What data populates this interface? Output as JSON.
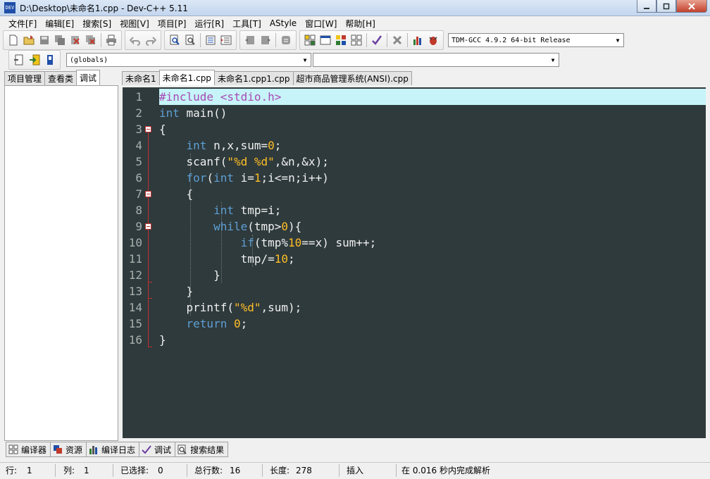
{
  "window": {
    "title": "D:\\Desktop\\未命名1.cpp - Dev-C++ 5.11",
    "icon_text": "DEV"
  },
  "menu": [
    "文件[F]",
    "编辑[E]",
    "搜索[S]",
    "视图[V]",
    "项目[P]",
    "运行[R]",
    "工具[T]",
    "AStyle",
    "窗口[W]",
    "帮助[H]"
  ],
  "compiler_select": {
    "value": "TDM-GCC 4.9.2 64-bit Release"
  },
  "scope_select": {
    "value": "(globals)"
  },
  "member_select": {
    "value": ""
  },
  "left_tabs": [
    {
      "label": "项目管理"
    },
    {
      "label": "查看类"
    },
    {
      "label": "调试"
    }
  ],
  "left_active_tab": "调试",
  "editor_tabs": [
    {
      "label": "未命名1"
    },
    {
      "label": "未命名1.cpp"
    },
    {
      "label": "未命名1.cpp1.cpp"
    },
    {
      "label": "超市商品管理系统(ANSI).cpp"
    }
  ],
  "editor_active_tab": "未命名1.cpp",
  "line_numbers": [
    "1",
    "2",
    "3",
    "4",
    "5",
    "6",
    "7",
    "8",
    "9",
    "10",
    "11",
    "12",
    "13",
    "14",
    "15",
    "16"
  ],
  "code_lines": [
    "#include <stdio.h>",
    "int main()",
    "{",
    "    int n,x,sum=0;",
    "    scanf(\"%d %d\",&n,&x);",
    "    for(int i=1;i<=n;i++)",
    "    {",
    "        int tmp=i;",
    "        while(tmp>0){",
    "            if(tmp%10==x) sum++;",
    "            tmp/=10;",
    "        }",
    "    }",
    "    printf(\"%d\",sum);",
    "    return 0;",
    "}"
  ],
  "bottom_tabs": [
    {
      "label": "编译器",
      "icon": "grid-icon"
    },
    {
      "label": "资源",
      "icon": "resources-icon"
    },
    {
      "label": "编译日志",
      "icon": "bar-chart-icon"
    },
    {
      "label": "调试",
      "icon": "check-icon"
    },
    {
      "label": "搜索结果",
      "icon": "search-icon"
    }
  ],
  "status": {
    "row_label": "行:",
    "row_value": "1",
    "col_label": "列:",
    "col_value": "1",
    "sel_label": "已选择:",
    "sel_value": "0",
    "lines_label": "总行数:",
    "lines_value": "16",
    "len_label": "长度:",
    "len_value": "278",
    "mode": "插入",
    "parse": "在 0.016 秒内完成解析"
  },
  "colors": {
    "editor_bg": "#2f3a3c",
    "keyword": "#5e9fd4",
    "number": "#ffbf26",
    "preprocessor": "#a84ab3",
    "current_line": "#c6f4f8"
  }
}
